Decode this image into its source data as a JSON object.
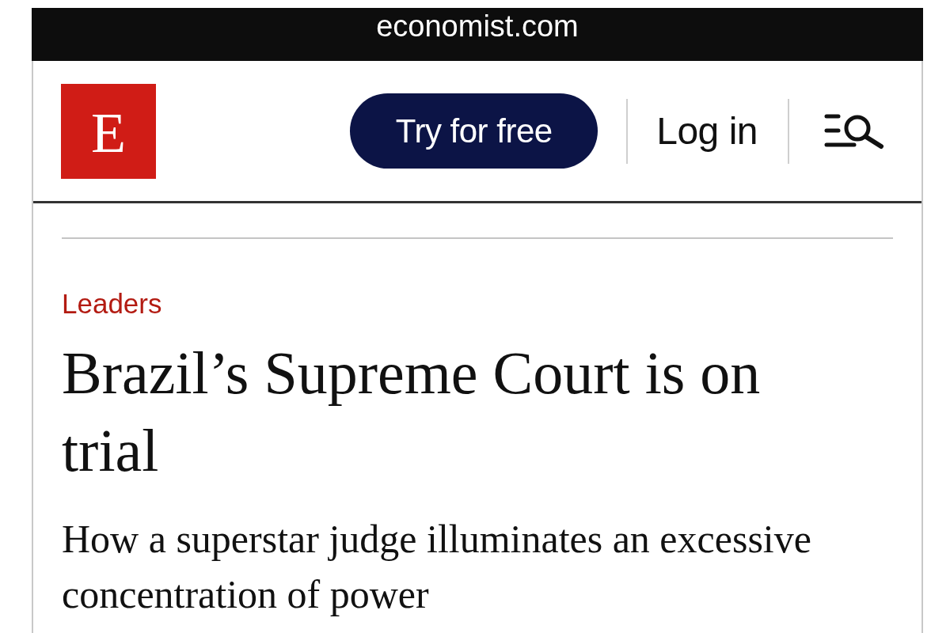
{
  "address_bar": {
    "url": "economist.com"
  },
  "header": {
    "logo": {
      "letter": "E"
    },
    "cta_button": "Try for free",
    "login_link": "Log in"
  },
  "article": {
    "section": "Leaders",
    "headline": "Brazil’s Supreme Court is on trial",
    "subheadline": "How a superstar judge illuminates an excessive concentration of power"
  }
}
